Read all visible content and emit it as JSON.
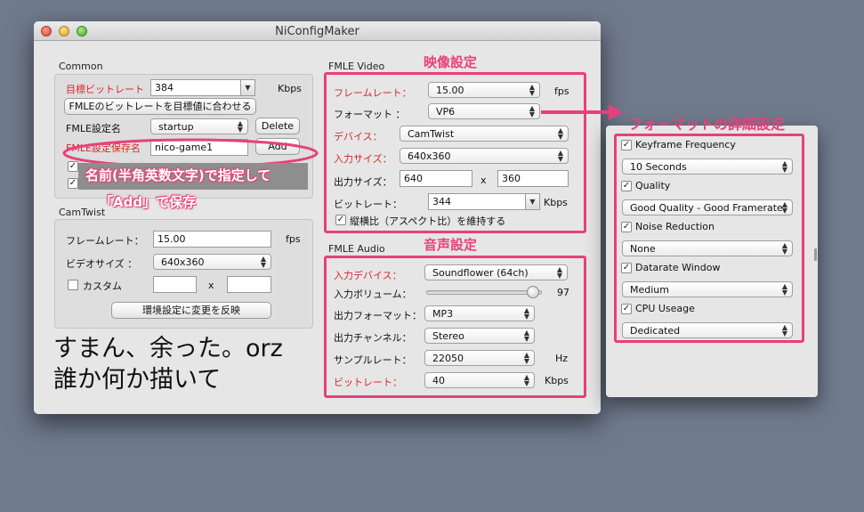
{
  "window": {
    "title": "NiConfigMaker"
  },
  "common": {
    "label": "Common",
    "target_bitrate_label": "目標ビットレート",
    "target_bitrate_value": "384",
    "target_bitrate_unit": "Kbps",
    "match_button": "FMLEのビットレートを目標値に合わせる",
    "fmle_name_label": "FMLE設定名",
    "fmle_name_value": "startup",
    "delete_button": "Delete",
    "save_name_label": "FMLE設定保存名",
    "save_name_value": "nico-game1",
    "add_button": "Add"
  },
  "camtwist": {
    "label": "CamTwist",
    "framerate_label": "フレームレート：",
    "framerate_value": "15.00",
    "framerate_unit": "fps",
    "videosize_label": "ビデオサイズ ：",
    "videosize_value": "640x360",
    "custom_label": "カスタム",
    "x_sep": "x",
    "apply_button": "環境設定に変更を反映"
  },
  "fmle_video": {
    "label": "FMLE Video",
    "framerate_label": "フレームレート：",
    "framerate_value": "15.00",
    "framerate_unit": "fps",
    "format_label": "フォーマット ：",
    "format_value": "VP6",
    "device_label": "デバイス：",
    "device_value": "CamTwist",
    "input_size_label": "入力サイズ：",
    "input_size_value": "640x360",
    "output_size_label": "出力サイズ：",
    "output_w": "640",
    "x_sep": "x",
    "output_h": "360",
    "bitrate_label": "ビットレート：",
    "bitrate_value": "344",
    "bitrate_unit": "Kbps",
    "aspect_label": "縦横比（アスペクト比）を維持する"
  },
  "fmle_audio": {
    "label": "FMLE Audio",
    "input_device_label": "入力デバイス：",
    "input_device_value": "Soundflower (64ch)",
    "volume_label": "入力ボリューム：",
    "volume_value": "97",
    "volume_fraction": 0.97,
    "output_format_label": "出力フォーマット：",
    "output_format_value": "MP3",
    "output_channel_label": "出力チャンネル：",
    "output_channel_value": "Stereo",
    "sample_rate_label": "サンプルレート：",
    "sample_rate_value": "22050",
    "sample_rate_unit": "Hz",
    "bitrate_label": "ビットレート：",
    "bitrate_value": "40",
    "bitrate_unit": "Kbps"
  },
  "format_details": {
    "keyframe_label": "Keyframe Frequency",
    "keyframe_value": "10 Seconds",
    "quality_label": "Quality",
    "quality_value": "Good Quality - Good Framerate",
    "noise_label": "Noise Reduction",
    "noise_value": "None",
    "datarate_label": "Datarate Window",
    "datarate_value": "Medium",
    "cpu_label": "CPU Useage",
    "cpu_value": "Dedicated"
  },
  "annotations": {
    "video_settings": "映像設定",
    "audio_settings": "音声設定",
    "format_details": "フォーマットの詳細設定",
    "name_hint_1": "名前(半角英数文字)で指定して",
    "name_hint_2": "「Add」で保存",
    "sorry_1": "すまん、余った。orz",
    "sorry_2": "誰か何か描いて"
  },
  "colors": {
    "annotation_pink": "#e8407a",
    "label_red": "#d9262c",
    "desktop": "#6f7a8c"
  },
  "icons": {
    "check": "check-icon",
    "popup_arrows": "up-down-arrows-icon",
    "combo_arrow": "down-triangle-icon"
  }
}
